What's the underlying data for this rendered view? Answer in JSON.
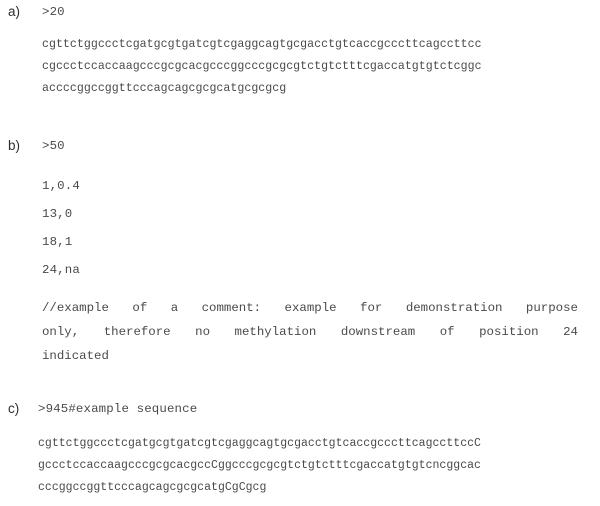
{
  "document": {
    "type": "figure",
    "background_color": "#ffffff",
    "text_color": "#4a4a4a",
    "parts": [
      {
        "label": "a)",
        "header": ">20",
        "sequence_lines": [
          "cgttctggccctcgatgcgtgatcgtcgaggcagtgcgacctgtcaccgcccttcagccttcc",
          "cgccctccaccaagcccgcgcacgcccggcccgcgcgtctgtctttcgaccatgtgtctcggc",
          "accccggccggttcccagcagcgcgcatgcgcgcg"
        ]
      },
      {
        "label": "b)",
        "header": ">50",
        "data_lines": [
          "1,0.4",
          "13,0",
          "18,1",
          "24,na"
        ],
        "comment_lines": [
          "//example of a comment: example for demonstration purpose",
          "only, therefore no methylation downstream of position 24",
          "indicated"
        ]
      },
      {
        "label": "c)",
        "header": ">945#example sequence",
        "sequence_lines": [
          "cgttctggccctcgatgcgtgatcgtcgaggcagtgcgacctgtcaccgcccttcagccttccC",
          "gccctccaccaagcccgcgcacgccCggcccgcgcgtctgtctttcgaccatgtgtcncggcac",
          "cccggccggttcccagcagcgcgcatgCgCgcg"
        ]
      }
    ]
  }
}
